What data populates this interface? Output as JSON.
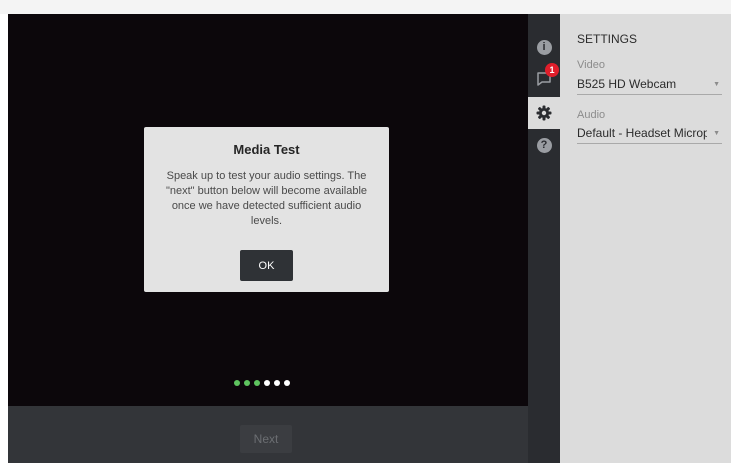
{
  "rail": {
    "info_icon": "info-icon",
    "chat_icon": "chat-icon",
    "chat_badge": "1",
    "settings_icon": "gear-icon",
    "help_icon": "help-icon"
  },
  "settings": {
    "title": "SETTINGS",
    "video_label": "Video",
    "video_value": "B525 HD Webcam",
    "audio_label": "Audio",
    "audio_value": "Default - Headset Microphone"
  },
  "modal": {
    "title": "Media Test",
    "body": "Speak up to test your audio settings. The \"next\" button below will become available once we have detected sufficient audio levels.",
    "ok_label": "OK"
  },
  "audio_level": {
    "active": 3,
    "total": 6,
    "active_color": "#5ec45f",
    "inactive_color": "#ffffff"
  },
  "footer": {
    "next_label": "Next"
  },
  "colors": {
    "video_bg": "#0c070b",
    "rail_bg": "#2a2c30",
    "panel_bg": "#dcdcdc",
    "badge": "#e01e2b"
  }
}
